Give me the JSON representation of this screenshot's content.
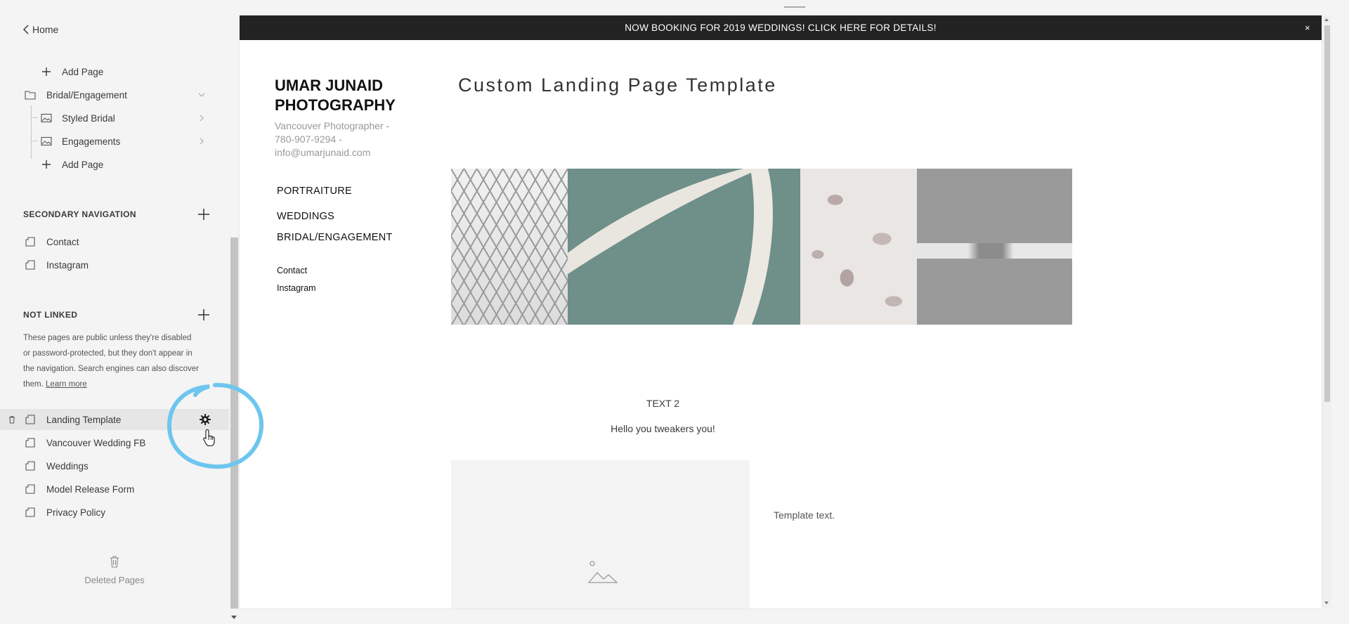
{
  "sidebar": {
    "back_label": "Home",
    "main_nav_tail": [
      {
        "label": "Add Page",
        "icon": "plus-icon"
      },
      {
        "label": "Bridal/Engagement",
        "icon": "folder-icon"
      },
      {
        "label": "Styled Bridal",
        "icon": "gallery-icon"
      },
      {
        "label": "Engagements",
        "icon": "gallery-icon"
      },
      {
        "label": "Add Page",
        "icon": "plus-icon"
      }
    ],
    "secondary_heading": "SECONDARY NAVIGATION",
    "secondary_items": [
      "Contact",
      "Instagram"
    ],
    "not_linked_heading": "NOT LINKED",
    "not_linked_note": "These pages are public unless they're disabled or password-protected, but they don't appear in the navigation. Search engines can also discover them.",
    "learn_more": "Learn more",
    "not_linked_items": [
      "Landing Template",
      "Vancouver Wedding FB",
      "Weddings",
      "Model Release Form",
      "Privacy Policy"
    ],
    "active_item": "Landing Template",
    "deleted_label": "Deleted Pages"
  },
  "preview": {
    "banner": "NOW BOOKING FOR 2019 WEDDINGS! CLICK HERE FOR DETAILS!",
    "banner_close": "×",
    "brand_line1": "UMAR JUNAID",
    "brand_line2": "PHOTOGRAPHY",
    "brand_sub1": "Vancouver Photographer -",
    "brand_sub2": "780-907-9294 -",
    "brand_sub3": "info@umarjunaid.com",
    "main_nav": [
      "PORTRAITURE",
      "WEDDINGS",
      "BRIDAL/ENGAGEMENT"
    ],
    "secondary_nav": [
      "Contact",
      "Instagram"
    ],
    "page_title": "Custom Landing Page Template",
    "text2_heading": "TEXT 2",
    "text2_body": "Hello you tweakers you!",
    "template_text": "Template text."
  },
  "colors": {
    "banner_bg": "#222222",
    "sidebar_bg": "#f4f4f4",
    "annotation_circle": "#6ec6ee"
  }
}
